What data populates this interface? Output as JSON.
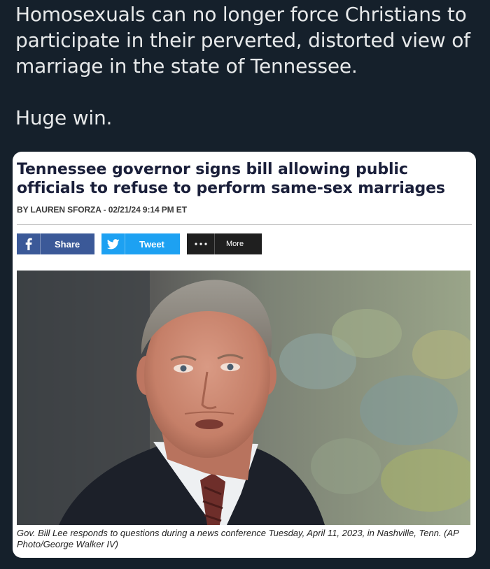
{
  "tweet": {
    "line1": "Homosexuals can no longer force Christians to participate in their perverted, distorted view of marriage in the state of Tennessee.",
    "line2": "Huge win."
  },
  "article": {
    "headline": "Tennessee governor signs bill allowing public officials to refuse to perform same-sex marriages",
    "byline": "BY LAUREN SFORZA - 02/21/24 9:14 PM ET",
    "share": {
      "facebook_label": "Share",
      "twitter_label": "Tweet",
      "more_label": "More"
    },
    "photo_alt": "Gov. Bill Lee",
    "caption": "Gov. Bill Lee responds to questions during a news conference Tuesday, April 11, 2023, in Nashville, Tenn. (AP Photo/George Walker IV)"
  },
  "colors": {
    "background": "#15202b",
    "facebook": "#3b5998",
    "twitter": "#1da1f2",
    "more": "#1f1f1f",
    "headline": "#1a1f3a"
  }
}
